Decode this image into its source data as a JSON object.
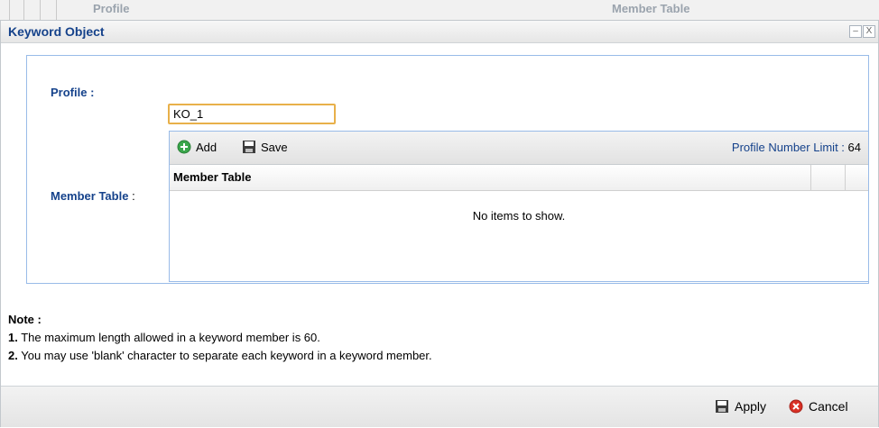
{
  "background": {
    "col_profile": "Profile",
    "col_member_table": "Member Table"
  },
  "dialog": {
    "title": "Keyword Object",
    "minimize_glyph": "–",
    "close_glyph": "X"
  },
  "form": {
    "profile_label": "Profile :",
    "profile_value": "KO_1",
    "member_table_label": "Member Table",
    "member_table_colon": ":"
  },
  "member_table": {
    "add_label": "Add",
    "save_label": "Save",
    "limit_label": "Profile Number Limit :",
    "limit_value": "64",
    "column_header": "Member Table",
    "empty_message": "No items to show."
  },
  "notes": {
    "title": "Note :",
    "items": [
      {
        "num": "1.",
        "text": "The maximum length allowed in a keyword member is 60."
      },
      {
        "num": "2.",
        "text": "You may use 'blank' character to separate each keyword in a keyword member."
      }
    ]
  },
  "footer": {
    "apply_label": "Apply",
    "cancel_label": "Cancel"
  },
  "colors": {
    "label_blue": "#15428b",
    "focus_border": "#e8b04a",
    "panel_border": "#99bbe8",
    "add_icon": "#3aa64b",
    "cancel_icon": "#d93025"
  },
  "icons": {
    "add": "add-circle-icon",
    "save": "floppy-disk-icon",
    "apply": "floppy-disk-icon",
    "cancel": "cancel-circle-icon"
  }
}
